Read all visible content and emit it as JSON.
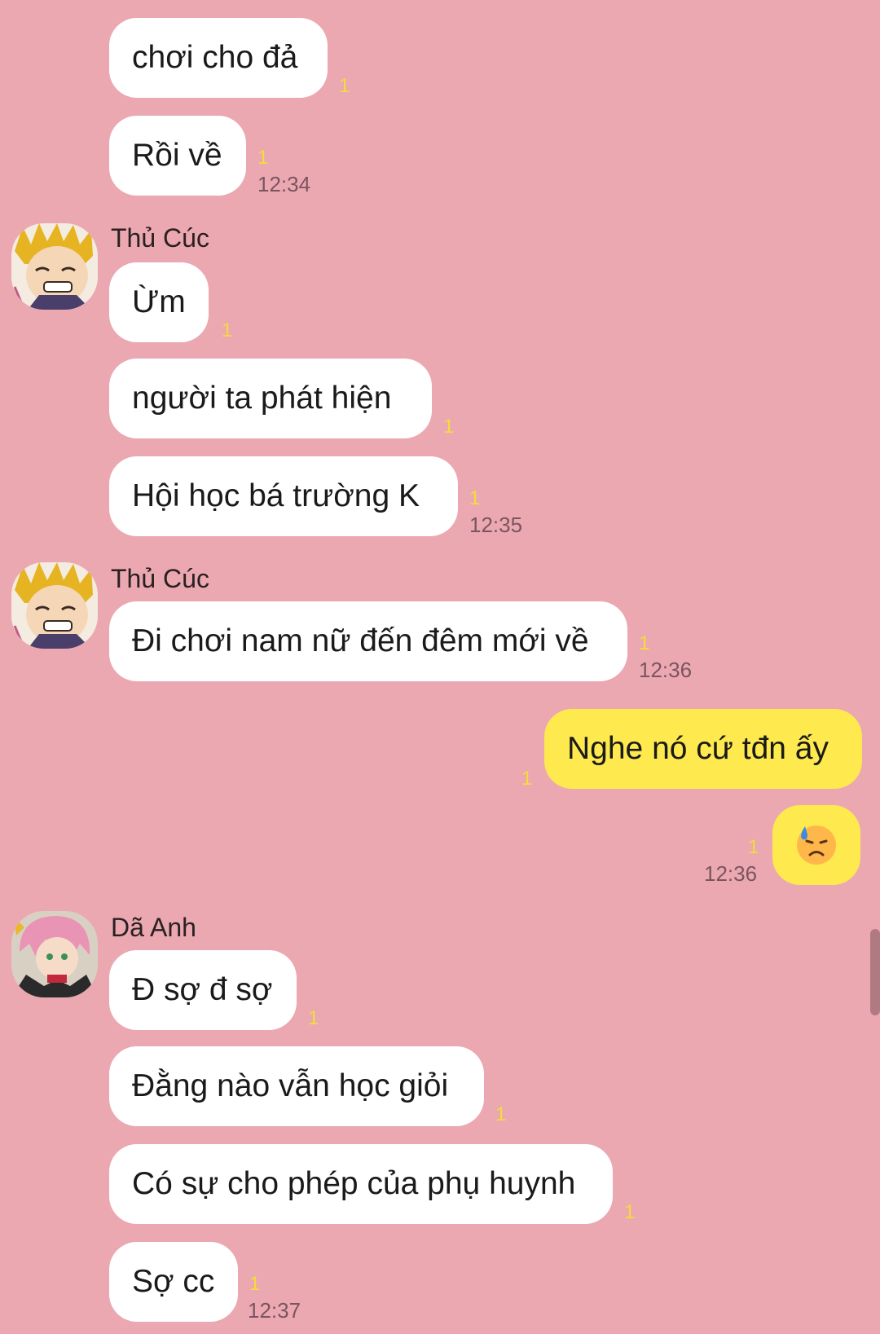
{
  "messages": {
    "m1": {
      "text": "chơi cho đả",
      "unread": "1"
    },
    "m2": {
      "text": "Rồi về",
      "unread": "1",
      "time": "12:34"
    },
    "g2": {
      "sender": "Thủ Cúc"
    },
    "m3": {
      "text": "Ừm",
      "unread": "1"
    },
    "m4": {
      "text": "người ta phát hiện",
      "unread": "1"
    },
    "m5": {
      "text": "Hội học bá trường K",
      "unread": "1",
      "time": "12:35"
    },
    "g3": {
      "sender": "Thủ Cúc"
    },
    "m6": {
      "text": "Đi chơi nam nữ đến đêm mới về",
      "unread": "1",
      "time": "12:36"
    },
    "m7": {
      "text": "Nghe nó cứ tđn ấy",
      "unread": "1"
    },
    "m8": {
      "emoji": "sad-sweat-emoji",
      "unread": "1",
      "time": "12:36"
    },
    "g4": {
      "sender": "Dã Anh"
    },
    "m9": {
      "text": "Đ sợ đ sợ",
      "unread": "1"
    },
    "m10": {
      "text": "Đằng nào vẫn học giỏi",
      "unread": "1"
    },
    "m11": {
      "text": "Có sự cho phép của phụ huynh",
      "unread": "1"
    },
    "m12": {
      "text": "Sợ cc",
      "unread": "1",
      "time": "12:37"
    }
  },
  "colors": {
    "background": "#eba8b1",
    "incoming_bubble": "#ffffff",
    "outgoing_bubble": "#fee94e",
    "unread_count": "#f3dc3c"
  }
}
